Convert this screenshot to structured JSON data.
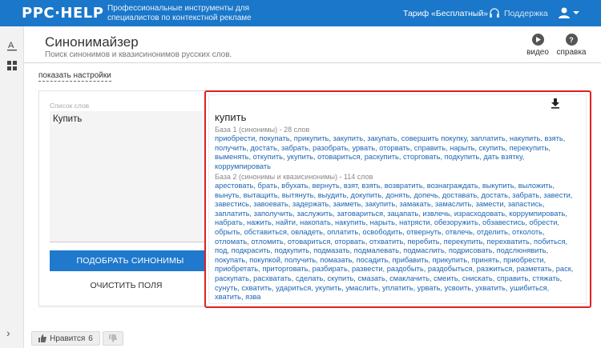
{
  "header": {
    "logo": "PPC·HELP",
    "tagline": "Профессиональные инструменты для специалистов по контекстной рекламе",
    "tariff": "Тариф «Бесплатный»",
    "support": "Поддержка"
  },
  "page": {
    "title": "Синонимайзер",
    "subtitle": "Поиск синонимов и квазисинонимов русских слов.",
    "video_label": "видео",
    "help_label": "справка",
    "show_settings": "показать настройки"
  },
  "form": {
    "field_label": "Список слов",
    "field_value": "Купить",
    "pick_button": "ПОДОБРАТЬ СИНОНИМЫ",
    "clear_button": "ОЧИСТИТЬ ПОЛЯ"
  },
  "result": {
    "word": "купить",
    "base1_heading": "База 1 (синонимы) - 28 слов",
    "base1_words": "приобрести, покупать, прикупить, закупить, закупать, совершить покупку, заплатить, накупить, взять, получить, достать, забрать, разобрать, урвать, оторвать, справить, нарыть, скупить, перекупить, выменять, откупить, укупить, отовариться, раскупить, сторговать, подкупить, дать взятку, коррумпировать",
    "base2_heading": "База 2 (синонимы и квазисинонимы) - 114 слов",
    "base2_words": "арестовать, брать, вбухать, вернуть, взят, взять, возвратить, вознаграждать, выкупить, выложить, вынуть, вытащить, вытянуть, выудить, докупить, донять, допечь, доставать, достать, забрать, завести, завестись, завоевать, задержать, заиметь, закупить, замакать, замаслить, замести, запастись, заплатить, заполучить, заслужить, затовариться, зацапать, извлечь, израсходовать, коррумпировать, набрать, нажить, найти, накопать, накупить, нарыть, натрясти, обезоружить, обзавестись, обрести, обрыть, обставиться, овладеть, оплатить, освободить, отвернуть, отвлечь, отделить, отколоть, отломать, отломить, отовариться, оторвать, отхватить, перебить, перекупить, перехватить, побиться, под, подкрасить, подкупить, подмазать, подмалевать, подмаслить, подрисовать, подслюнявить, покупать, покупкой, получить, помазать, посадить, прибавить, прикупить, принять, приобрести, приобретать, приторговать, разбирать, развести, раздобыть, раздобыться, разжиться, разметать, раск, раскупать, расхватать, сделать, скупить, смазать, смаклачить, смеить, снискать, справить, стяжать, сунуть, схватить, удариться, укупить, умаслить, уплатить, урвать, усвоить, ухватить, ушибиться, хватить, язва"
  },
  "footer": {
    "like_label": "Нравится",
    "like_count": "6"
  },
  "colors": {
    "topbar": "#1a77c9",
    "primary_button": "#1f79cc",
    "highlight_border": "#e02020",
    "link": "#1d66b3"
  },
  "icons": [
    "download-icon",
    "play-icon",
    "help-icon",
    "headset-icon",
    "user-icon",
    "spellcheck-icon",
    "grid-icon",
    "thumbs-up-icon",
    "thumbs-down-icon",
    "chevron-right-icon"
  ]
}
